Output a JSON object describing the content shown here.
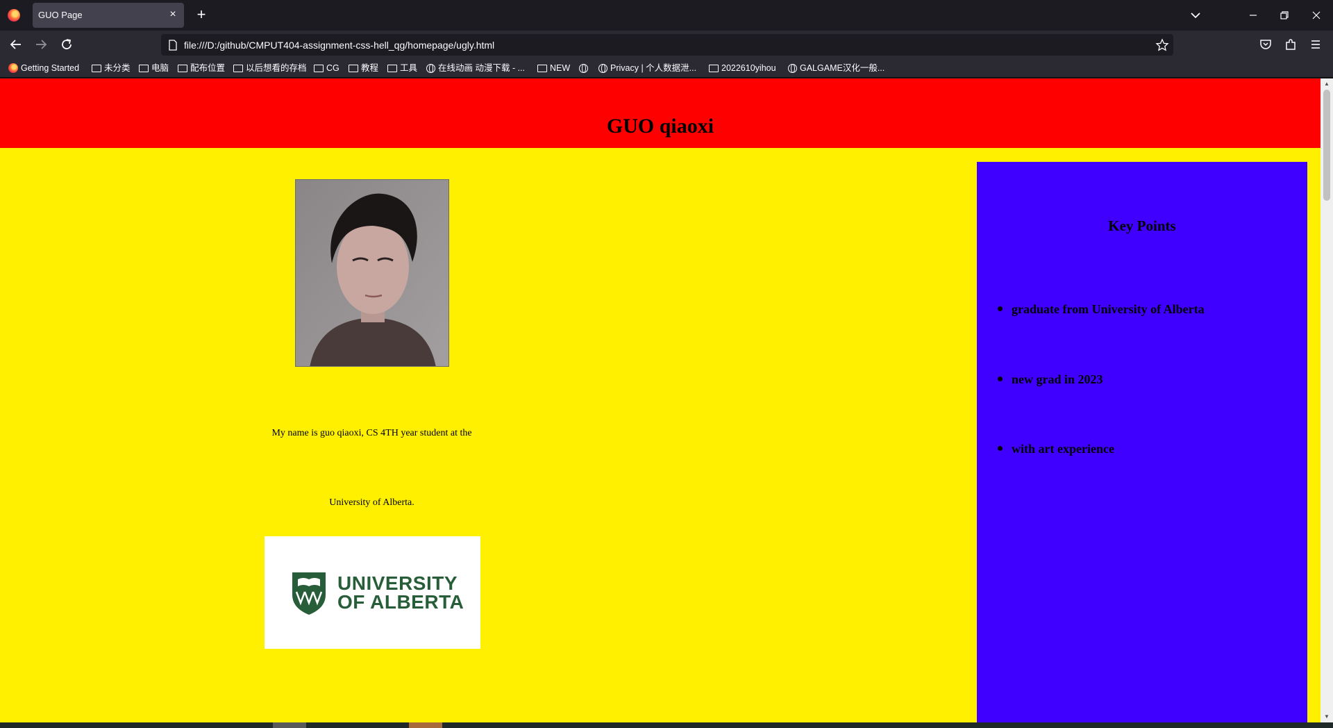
{
  "browser": {
    "tab_title": "GUO Page",
    "url": "file:///D:/github/CMPUT404-assignment-css-hell_qg/homepage/ugly.html",
    "bookmarks": [
      {
        "label": "Getting Started",
        "icon": "firefox-icon"
      },
      {
        "label": "未分类",
        "icon": "folder-icon"
      },
      {
        "label": "电脑",
        "icon": "folder-icon"
      },
      {
        "label": "配布位置",
        "icon": "folder-icon"
      },
      {
        "label": "以后想看的存档",
        "icon": "folder-icon"
      },
      {
        "label": "CG",
        "icon": "folder-icon"
      },
      {
        "label": "教程",
        "icon": "folder-icon"
      },
      {
        "label": "工具",
        "icon": "folder-icon"
      },
      {
        "label": "在线动画 动漫下载 - ...",
        "icon": "globe-icon"
      },
      {
        "label": "NEW",
        "icon": "folder-icon"
      },
      {
        "label": "",
        "icon": "globe-icon"
      },
      {
        "label": "Privacy | 个人数据泄...",
        "icon": "globe-icon"
      },
      {
        "label": "2022610yihou",
        "icon": "folder-icon"
      },
      {
        "label": "GALGAME汉化一般...",
        "icon": "globe-icon"
      }
    ]
  },
  "page": {
    "title": "GUO qiaoxi",
    "intro_line_1": "My name is guo qiaoxi, CS 4TH year student at the",
    "intro_line_2": "University of Alberta.",
    "logo_line_1": "UNIVERSITY",
    "logo_line_2": "OF ALBERTA",
    "sidebar": {
      "title": "Key Points",
      "items": [
        "graduate from University of Alberta",
        "new grad in 2023",
        "with art experience"
      ]
    }
  },
  "colors": {
    "header_bg": "#ff0000",
    "body_bg": "#fff000",
    "sidebar_bg": "#4000ff",
    "ua_green": "#275d38"
  }
}
